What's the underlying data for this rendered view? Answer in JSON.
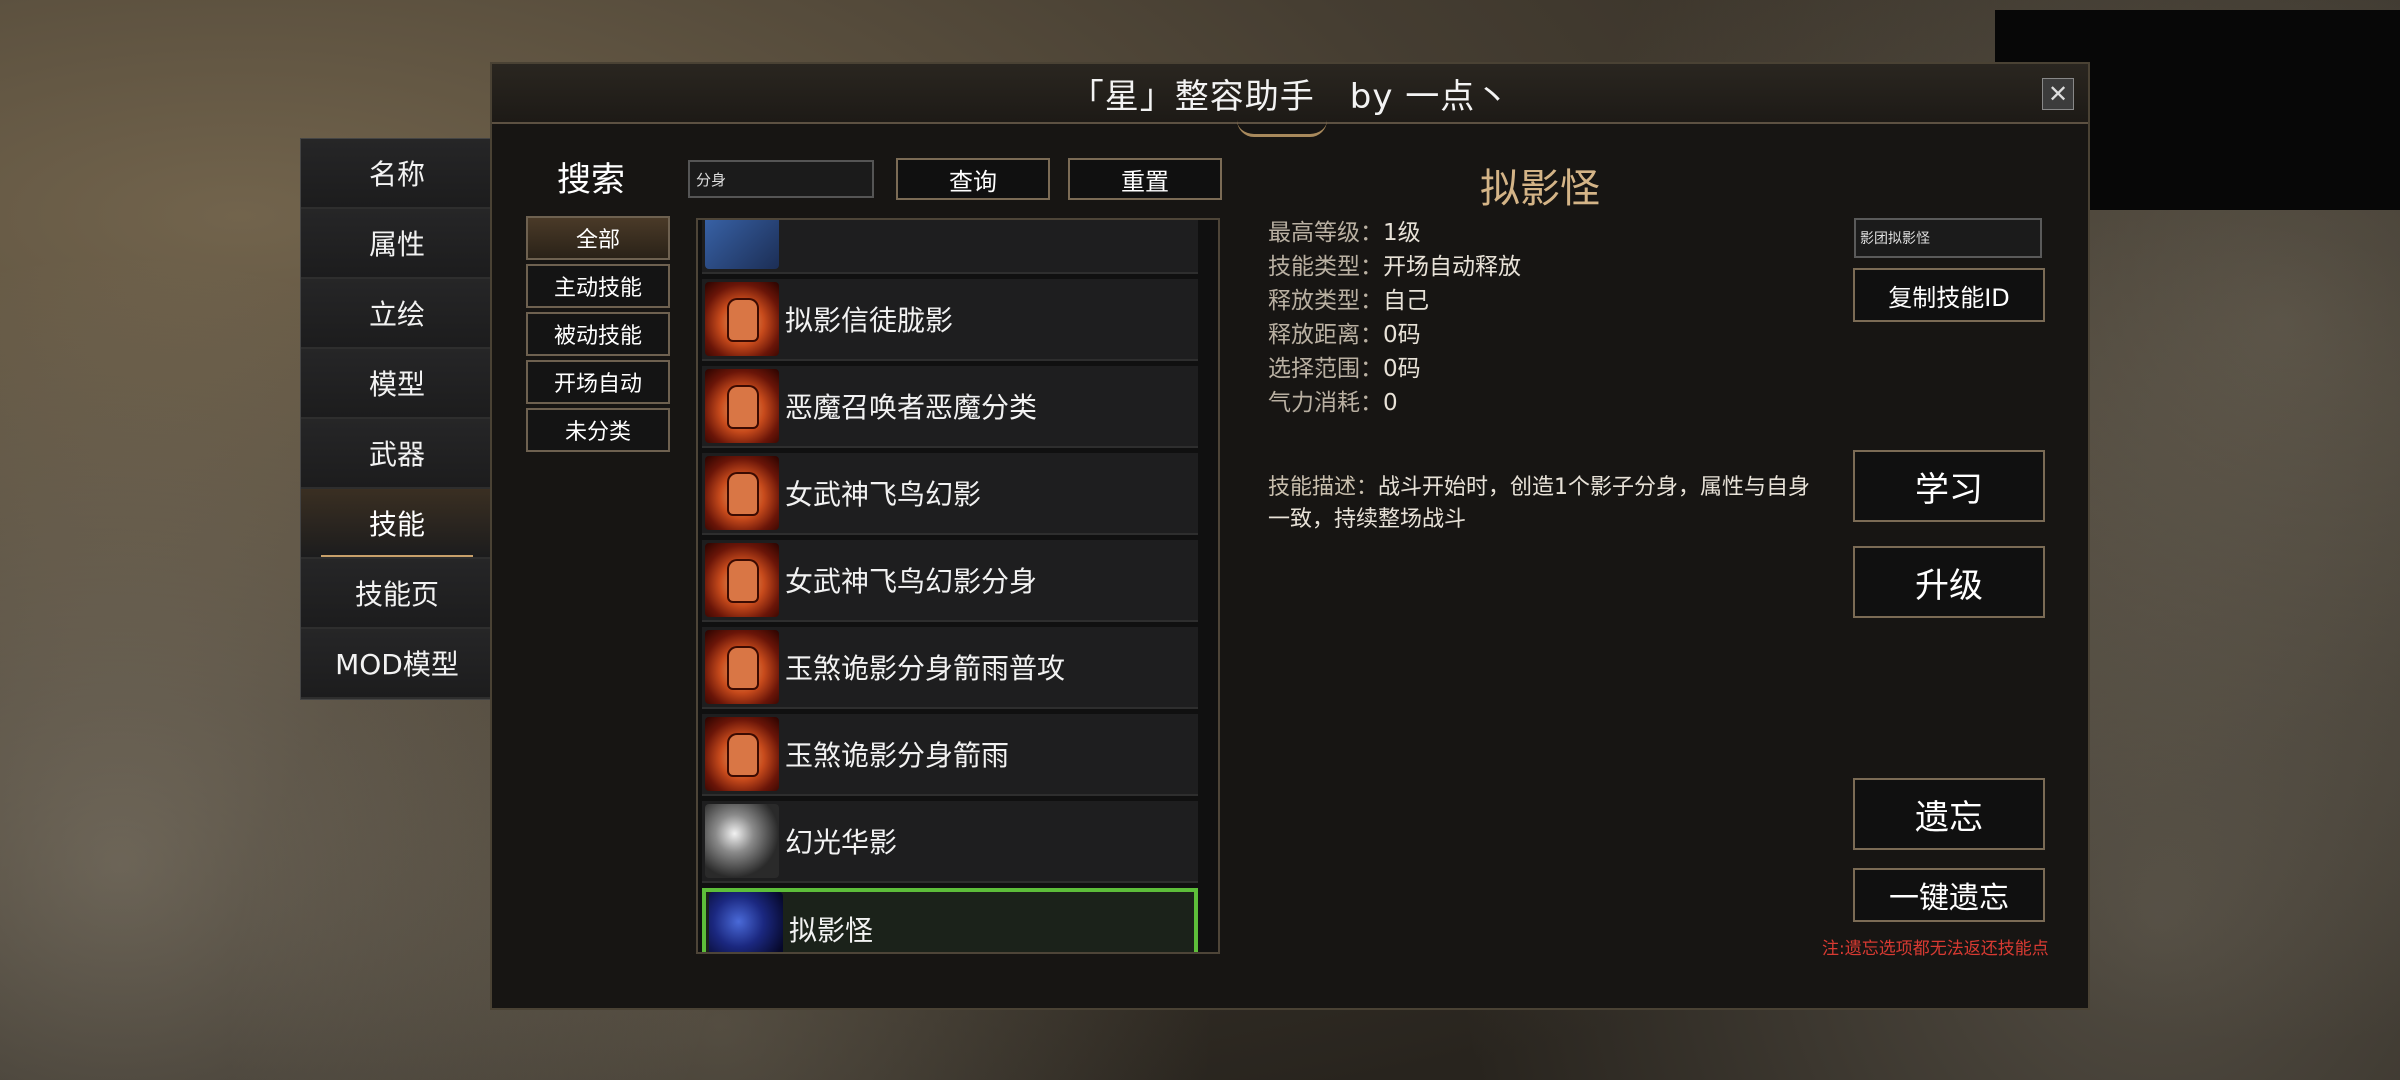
{
  "window": {
    "title": "「星」整容助手　by 一点丶"
  },
  "nav": {
    "items": [
      {
        "label": "名称"
      },
      {
        "label": "属性"
      },
      {
        "label": "立绘"
      },
      {
        "label": "模型"
      },
      {
        "label": "武器"
      },
      {
        "label": "技能",
        "active": true
      },
      {
        "label": "技能页"
      },
      {
        "label": "MOD模型"
      }
    ]
  },
  "search": {
    "label": "搜索",
    "value": "分身",
    "query_button": "查询",
    "reset_button": "重置"
  },
  "filters": [
    {
      "label": "全部",
      "active": true
    },
    {
      "label": "主动技能"
    },
    {
      "label": "被动技能"
    },
    {
      "label": "开场自动"
    },
    {
      "label": "未分类"
    }
  ],
  "skills": [
    {
      "label": "",
      "icon": "blue-icon"
    },
    {
      "label": "拟影信徒胧影",
      "icon": "fist-icon"
    },
    {
      "label": "恶魔召唤者恶魔分类",
      "icon": "fist-icon"
    },
    {
      "label": "女武神飞鸟幻影",
      "icon": "fist-icon"
    },
    {
      "label": "女武神飞鸟幻影分身",
      "icon": "fist-icon"
    },
    {
      "label": "玉煞诡影分身箭雨普攻",
      "icon": "fist-icon"
    },
    {
      "label": "玉煞诡影分身箭雨",
      "icon": "fist-icon"
    },
    {
      "label": "幻光华影",
      "icon": "light-icon"
    },
    {
      "label": "拟影怪",
      "icon": "shadow-icon",
      "selected": true
    }
  ],
  "detail": {
    "name": "拟影怪",
    "stats": [
      {
        "key": "最高等级：",
        "value": "1级"
      },
      {
        "key": "技能类型：",
        "value": "开场自动释放"
      },
      {
        "key": "释放类型：",
        "value": "自己"
      },
      {
        "key": "释放距离：",
        "value": "0码"
      },
      {
        "key": "选择范围：",
        "value": "0码"
      },
      {
        "key": "气力消耗：",
        "value": "0"
      }
    ],
    "description_label": "技能描述：",
    "description": "战斗开始时，创造1个影子分身，属性与自身一致，持续整场战斗",
    "skill_id": "影团拟影怪"
  },
  "actions": {
    "copy_id": "复制技能ID",
    "learn": "学习",
    "upgrade": "升级",
    "forget": "遗忘",
    "forget_all": "一键遗忘",
    "note": "注:遗忘选项都无法返还技能点"
  },
  "colors": {
    "accent": "#d4b487",
    "selected_border": "#5dbe3a",
    "warning": "#d83a32"
  }
}
